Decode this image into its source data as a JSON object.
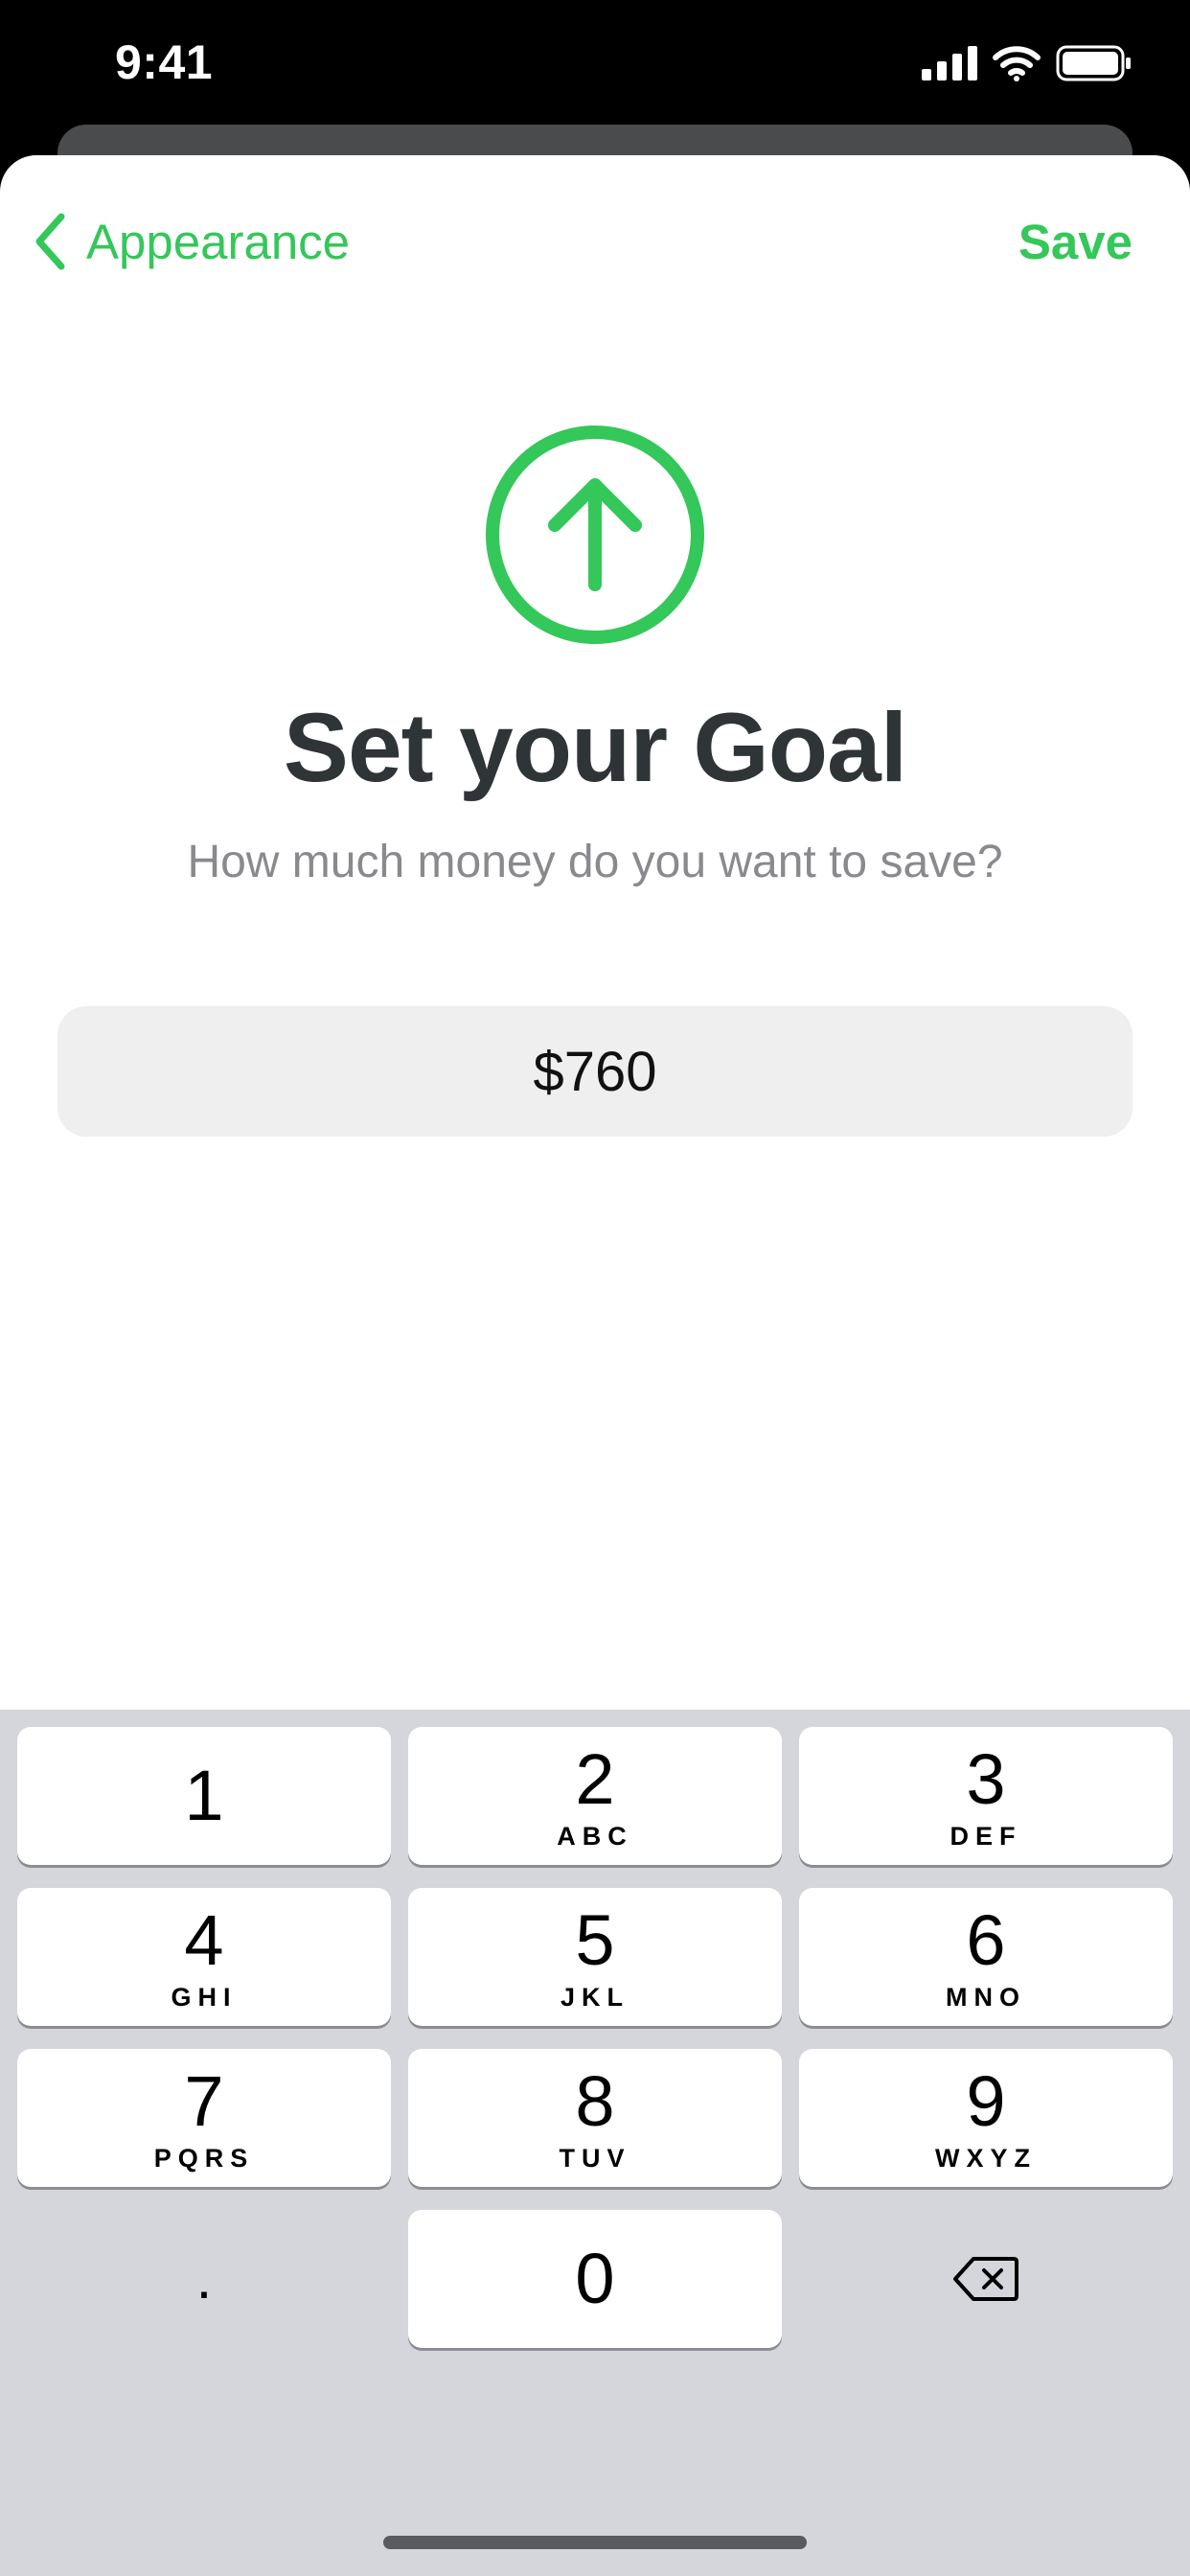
{
  "status_bar": {
    "time": "9:41",
    "icons": [
      "cellular-signal-icon",
      "wifi-icon",
      "battery-icon"
    ]
  },
  "nav": {
    "back_label": "Appearance",
    "save_label": "Save"
  },
  "goal": {
    "icon": "arrow-up-circle-icon",
    "title": "Set your Goal",
    "subtitle": "How much money do you want to save?",
    "amount_value": "$760"
  },
  "keypad": {
    "keys": [
      {
        "digit": "1",
        "letters": ""
      },
      {
        "digit": "2",
        "letters": "ABC"
      },
      {
        "digit": "3",
        "letters": "DEF"
      },
      {
        "digit": "4",
        "letters": "GHI"
      },
      {
        "digit": "5",
        "letters": "JKL"
      },
      {
        "digit": "6",
        "letters": "MNO"
      },
      {
        "digit": "7",
        "letters": "PQRS"
      },
      {
        "digit": "8",
        "letters": "TUV"
      },
      {
        "digit": "9",
        "letters": "WXYZ"
      },
      {
        "digit": "0",
        "letters": ""
      }
    ],
    "decimal_label": ".",
    "delete_icon": "delete-backspace-icon"
  },
  "colors": {
    "accent": "#34c759",
    "title_text": "#2f3437",
    "subtitle_text": "#8a8a8e",
    "input_background": "#efefef",
    "keyboard_background": "#d5d6db"
  }
}
